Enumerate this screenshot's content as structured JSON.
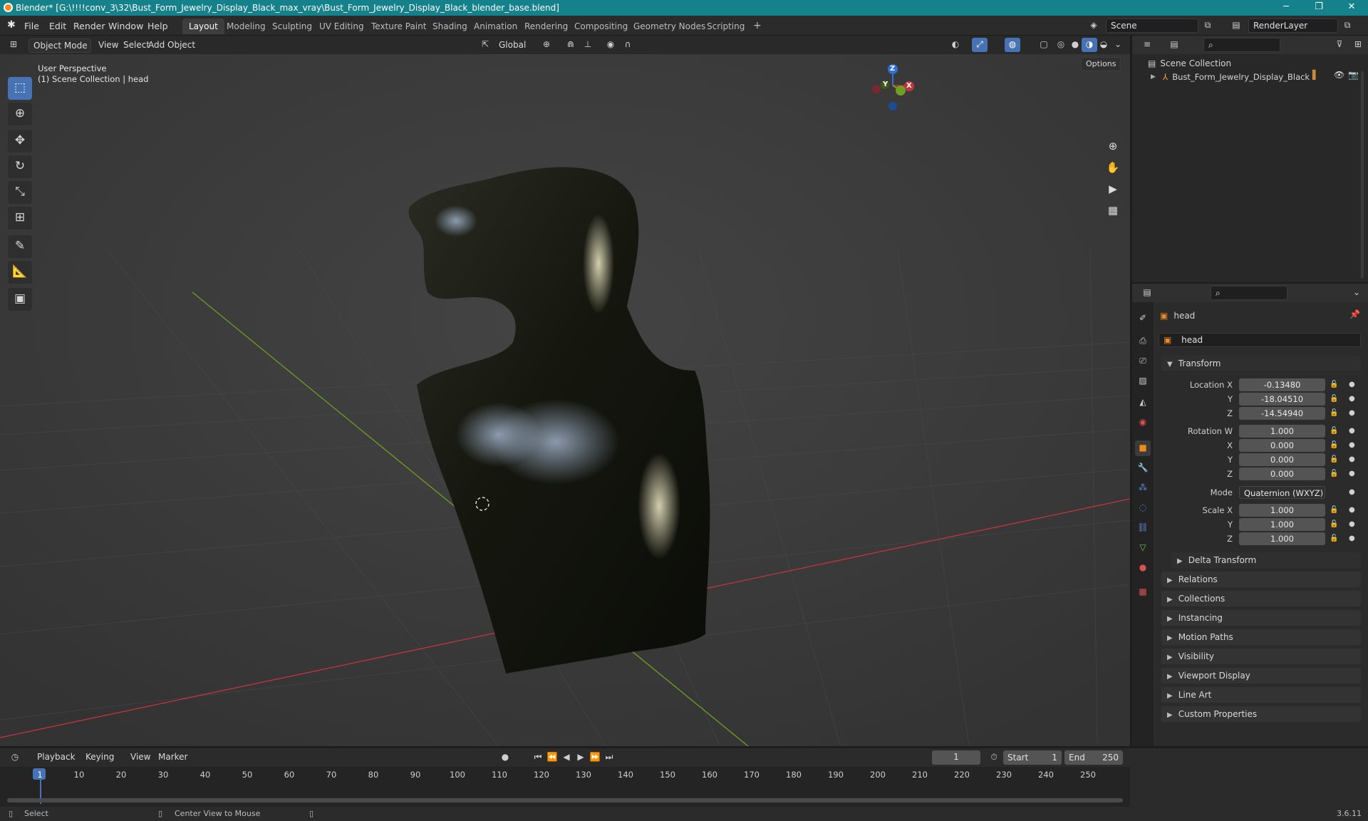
{
  "window": {
    "title": "Blender* [G:\\!!!!conv_3\\32\\Bust_Form_Jewelry_Display_Black_max_vray\\Bust_Form_Jewelry_Display_Black_blender_base.blend]",
    "minimize": "─",
    "maximize": "❐",
    "close": "✕"
  },
  "menubar": {
    "menus": [
      "File",
      "Edit",
      "Render",
      "Window",
      "Help"
    ],
    "workspaces": [
      "Layout",
      "Modeling",
      "Sculpting",
      "UV Editing",
      "Texture Paint",
      "Shading",
      "Animation",
      "Rendering",
      "Compositing",
      "Geometry Nodes",
      "Scripting"
    ],
    "active_workspace": "Layout",
    "add_workspace": "+",
    "scene": "Scene",
    "render_layer": "RenderLayer"
  },
  "viewport": {
    "mode": "Object Mode",
    "menus": [
      "View",
      "Select",
      "Add",
      "Object"
    ],
    "transform_orientation": "Global",
    "options": "Options",
    "overlay_line1": "User Perspective",
    "overlay_line2": "(1) Scene Collection | head",
    "gizmo": {
      "x": "X",
      "y": "Y",
      "z": "Z"
    }
  },
  "outliner": {
    "root": "Scene Collection",
    "items": [
      {
        "label": "Bust_Form_Jewelry_Display_Black"
      }
    ]
  },
  "properties": {
    "object_name": "head",
    "data_name": "head",
    "section_transform": "Transform",
    "location": {
      "label": "Location X",
      "x": "-0.13480",
      "y": "-18.04510",
      "z": "-14.54940"
    },
    "rotation": {
      "label": "Rotation W",
      "w": "1.000",
      "x": "0.000",
      "y": "0.000",
      "z": "0.000"
    },
    "axis_labels": {
      "x": "X",
      "y": "Y",
      "z": "Z"
    },
    "mode_label": "Mode",
    "mode_value": "Quaternion (WXYZ)",
    "scale": {
      "label": "Scale X",
      "x": "1.000",
      "y": "1.000",
      "z": "1.000"
    },
    "delta_transform": "Delta Transform",
    "panels": [
      "Relations",
      "Collections",
      "Instancing",
      "Motion Paths",
      "Visibility",
      "Viewport Display",
      "Line Art",
      "Custom Properties"
    ]
  },
  "timeline": {
    "menus": [
      "Playback",
      "Keying",
      "View",
      "Marker"
    ],
    "current_frame": "1",
    "start_label": "Start",
    "start": "1",
    "end_label": "End",
    "end": "250",
    "ticks": [
      "1",
      "10",
      "20",
      "30",
      "40",
      "50",
      "60",
      "70",
      "80",
      "90",
      "100",
      "110",
      "120",
      "130",
      "140",
      "150",
      "160",
      "170",
      "180",
      "190",
      "200",
      "210",
      "220",
      "230",
      "240",
      "250"
    ]
  },
  "statusbar": {
    "left": "Select",
    "middle": "Center View to Mouse",
    "version": "3.6.11"
  },
  "colors": {
    "accent": "#4772b3",
    "titlebar": "#15818a",
    "x_axis": "#c4343f",
    "y_axis": "#6e9e23",
    "z_axis": "#2f6fd6"
  }
}
